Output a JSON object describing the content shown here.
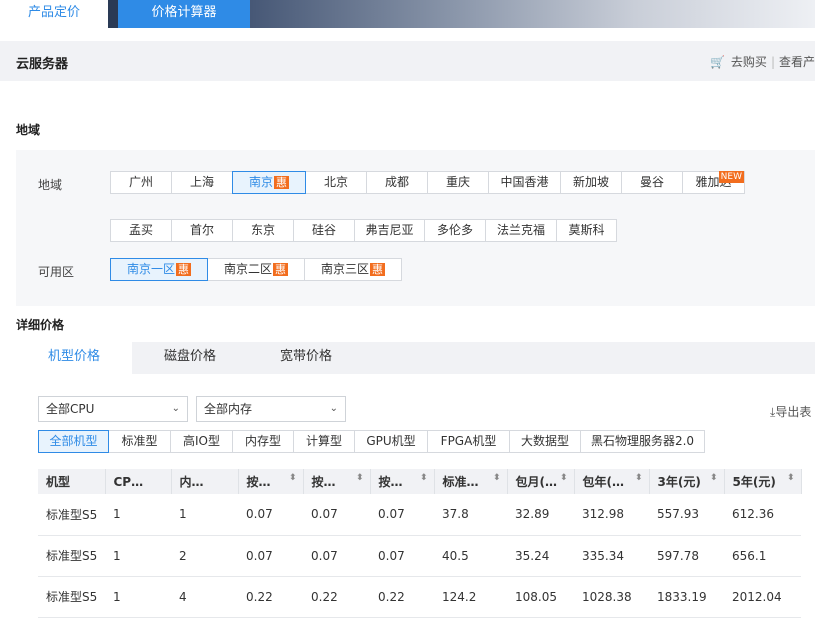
{
  "top_tabs": [
    "产品定价",
    "价格计算器"
  ],
  "section": {
    "title": "云服务器",
    "buy": "去购买",
    "more": "查看产"
  },
  "region_title": "地域",
  "region_label": "地域",
  "regions_row1": [
    {
      "name": "广州"
    },
    {
      "name": "上海"
    },
    {
      "name": "南京",
      "hui": "惠",
      "active": true
    },
    {
      "name": "北京"
    },
    {
      "name": "成都"
    },
    {
      "name": "重庆"
    },
    {
      "name": "中国香港"
    },
    {
      "name": "新加坡"
    },
    {
      "name": "曼谷"
    },
    {
      "name": "雅加达",
      "tag": "NEW"
    }
  ],
  "regions_row2": [
    "孟买",
    "首尔",
    "东京",
    "硅谷",
    "弗吉尼亚",
    "多伦多",
    "法兰克福",
    "莫斯科"
  ],
  "zone_label": "可用区",
  "zones": [
    {
      "name": "南京一区",
      "hui": "惠",
      "active": true
    },
    {
      "name": "南京二区",
      "hui": "惠"
    },
    {
      "name": "南京三区",
      "hui": "惠"
    }
  ],
  "detail_title": "详细价格",
  "price_tabs": [
    "机型价格",
    "磁盘价格",
    "宽带价格"
  ],
  "filters": {
    "cpu": "全部CPU",
    "memory": "全部内存"
  },
  "export": "导出表",
  "instance_types": [
    "全部机型",
    "标准型",
    "高IO型",
    "内存型",
    "计算型",
    "GPU机型",
    "FPGA机型",
    "大数据型",
    "黑石物理服务器2.0"
  ],
  "table": {
    "headers": [
      "机型",
      "CP…",
      "内…",
      "按…",
      "按…",
      "按…",
      "标准…",
      "包月(…",
      "包年(…",
      "3年(元)",
      "5年(元)"
    ],
    "sortable": [
      false,
      false,
      false,
      true,
      true,
      true,
      true,
      true,
      true,
      true,
      true
    ],
    "rows": [
      [
        "标准型S5",
        "1",
        "1",
        "0.07",
        "0.07",
        "0.07",
        "37.8",
        "32.89",
        "312.98",
        "557.93",
        "612.36"
      ],
      [
        "标准型S5",
        "1",
        "2",
        "0.07",
        "0.07",
        "0.07",
        "40.5",
        "35.24",
        "335.34",
        "597.78",
        "656.1"
      ],
      [
        "标准型S5",
        "1",
        "4",
        "0.22",
        "0.22",
        "0.22",
        "124.2",
        "108.05",
        "1028.38",
        "1833.19",
        "2012.04"
      ]
    ]
  }
}
